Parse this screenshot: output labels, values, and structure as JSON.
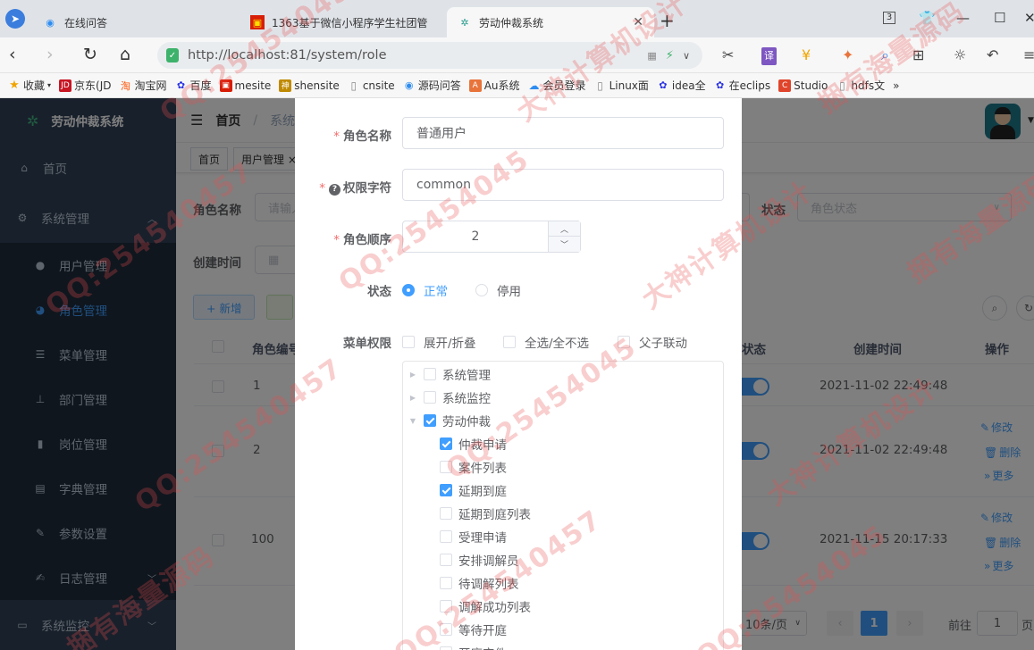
{
  "browser": {
    "tabs": [
      {
        "title": "在线问答",
        "active": false
      },
      {
        "title": "1363基于微信小程序学生社团管",
        "active": false
      },
      {
        "title": "劳动仲裁系统",
        "active": true
      }
    ],
    "tab_count": "3",
    "url": "http://localhost:81/system/role",
    "bookmarks": [
      "收藏",
      "京东(JD",
      "淘宝网",
      "百度",
      "mesite",
      "shensite",
      "cnsite",
      "源码问答",
      "Au系统",
      "会员登录",
      "Linux面",
      "idea全",
      "在eclips",
      "Studio",
      "hdfs文"
    ],
    "bookmarks_more": "»"
  },
  "sidebar": {
    "brand": "劳动仲裁系统",
    "items": [
      {
        "label": "首页",
        "icon": "home-icon"
      },
      {
        "label": "系统管理",
        "icon": "gear-icon"
      },
      {
        "label": "用户管理",
        "icon": "user-icon"
      },
      {
        "label": "角色管理",
        "icon": "users-icon"
      },
      {
        "label": "菜单管理",
        "icon": "tree-table-icon"
      },
      {
        "label": "部门管理",
        "icon": "org-icon"
      },
      {
        "label": "岗位管理",
        "icon": "post-icon"
      },
      {
        "label": "字典管理",
        "icon": "dict-icon"
      },
      {
        "label": "参数设置",
        "icon": "edit-icon"
      },
      {
        "label": "日志管理",
        "icon": "log-icon"
      },
      {
        "label": "系统监控",
        "icon": "monitor-icon"
      }
    ]
  },
  "navbar": {
    "breadcrumb": [
      "首页",
      "系统"
    ]
  },
  "tags": [
    "首页",
    "用户管理 ×"
  ],
  "search": {
    "role_name_label": "角色名称",
    "role_name_placeholder": "请输入",
    "status_label": "状态",
    "status_placeholder": "角色状态",
    "created_label": "创建时间"
  },
  "toolbar": {
    "add_label": "+ 新增"
  },
  "table": {
    "headers": [
      "角色编号",
      "状态",
      "创建时间",
      "操作"
    ],
    "rows": [
      {
        "id": "1",
        "created": "2021-11-02 22:49:48"
      },
      {
        "id": "2",
        "created": "2021-11-02 22:49:48"
      },
      {
        "id": "100",
        "created": "2021-11-15 20:17:33"
      }
    ],
    "actions": [
      "修改",
      "删除",
      "更多"
    ]
  },
  "pagination": {
    "page_size": "10条/页",
    "current_page": "1",
    "goto_label": "前往",
    "goto_value": "1",
    "page_suffix": "页"
  },
  "dialog": {
    "role_name_label": "角色名称",
    "role_name_value": "普通用户",
    "role_key_label": "权限字符",
    "role_key_value": "common",
    "role_sort_label": "角色顺序",
    "role_sort_value": "2",
    "status_label": "状态",
    "status_options": [
      "正常",
      "停用"
    ],
    "status_selected": "正常",
    "menu_perm_label": "菜单权限",
    "menu_perm_options": [
      "展开/折叠",
      "全选/全不选",
      "父子联动"
    ],
    "tree": [
      {
        "label": "系统管理",
        "level": 0,
        "checked": false,
        "caret": "right"
      },
      {
        "label": "系统监控",
        "level": 0,
        "checked": false,
        "caret": "right"
      },
      {
        "label": "劳动仲裁",
        "level": 0,
        "checked": true,
        "caret": "down"
      },
      {
        "label": "仲裁申请",
        "level": 1,
        "checked": true
      },
      {
        "label": "案件列表",
        "level": 1,
        "checked": false
      },
      {
        "label": "延期到庭",
        "level": 1,
        "checked": true
      },
      {
        "label": "延期到庭列表",
        "level": 1,
        "checked": false
      },
      {
        "label": "受理申请",
        "level": 1,
        "checked": false
      },
      {
        "label": "安排调解员",
        "level": 1,
        "checked": false
      },
      {
        "label": "待调解列表",
        "level": 1,
        "checked": false
      },
      {
        "label": "调解成功列表",
        "level": 1,
        "checked": false
      },
      {
        "label": "等待开庭",
        "level": 1,
        "checked": false
      },
      {
        "label": "开庭审件",
        "level": 1,
        "checked": false
      }
    ]
  },
  "watermarks": [
    "QQ:25454045",
    "大神计算机设计",
    "捆有海量源码",
    "QQ:254540457"
  ],
  "colors": {
    "primary": "#409eff",
    "sidebar_bg": "#304156",
    "sidebar_sub_bg": "#1f2d3d",
    "required": "#f56c6c"
  }
}
